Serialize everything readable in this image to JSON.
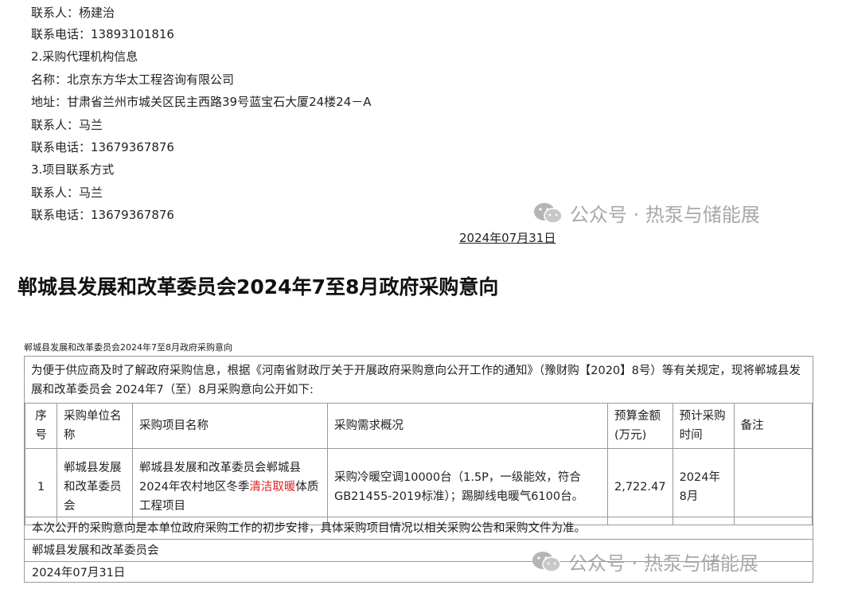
{
  "top_section": {
    "lines": [
      "联系人：杨建治",
      "联系电话：13893101816",
      "2.采购代理机构信息",
      "名称：北京东方华太工程咨询有限公司",
      "地址：甘肃省兰州市城关区民主西路39号蓝宝石大厦24楼24－A",
      "联系人：马兰",
      "联系电话：13679367876",
      "3.项目联系方式",
      "联系人：马兰",
      "联系电话：13679367876"
    ],
    "date": "2024年07月31日"
  },
  "watermark": {
    "text": "公众号 · 热泵与储能展",
    "icon": "wechat-icon"
  },
  "heading": "郸城县发展和改革委员会2024年7至8月政府采购意向",
  "notice": {
    "caption": "郸城县发展和改革委员会2024年7至8月政府采购意向",
    "intro": "为便于供应商及时了解政府采购信息，根据《河南省财政厅关于开展政府采购意向公开工作的通知》（豫财购【2020】8号）等有关规定，现将郸城县发展和改革委员会 2024年7（至）8月采购意向公开如下:",
    "headers": [
      "序号",
      "采购单位名称",
      "采购项目名称",
      "采购需求概况",
      "预算金额(万元)",
      "预计采购时间",
      "备注"
    ],
    "row": {
      "no": "1",
      "unit": "郸城县发展和改革委员会",
      "project_before": "郸城县发展和改革委员会郸城县2024年农村地区冬季",
      "project_highlight": "清洁取暖",
      "project_after": "体质工程项目",
      "demand": "采购冷暖空调10000台（1.5P，一级能效，符合GB21455-2019标准）；踢脚线电暖气6100台。",
      "budget": "2,722.47",
      "time": "2024年8月",
      "remark": ""
    },
    "footer_note": "本次公开的采购意向是本单位政府采购工作的初步安排，具体采购项目情况以相关采购公告和采购文件为准。",
    "footer_org": "郸城县发展和改革委员会",
    "footer_date": "2024年07月31日"
  },
  "colors": {
    "highlight": "#e02020",
    "watermark": "#a8a8a8"
  }
}
